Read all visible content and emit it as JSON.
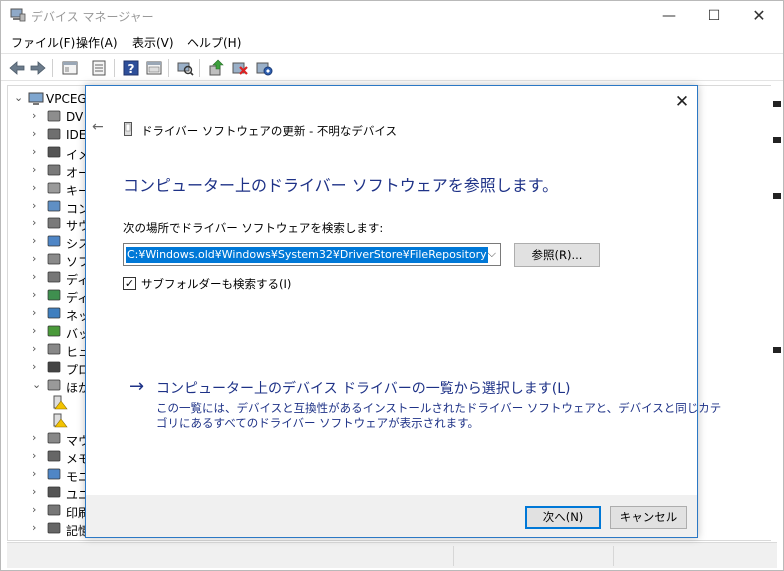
{
  "window": {
    "title": "デバイス マネージャー",
    "controls": {
      "minimize": "—",
      "maximize": "☐",
      "close": "✕"
    }
  },
  "menu": [
    {
      "label": "ファイル(F)"
    },
    {
      "label": "操作(A)"
    },
    {
      "label": "表示(V)"
    },
    {
      "label": "ヘルプ(H)"
    }
  ],
  "toolbar": {
    "buttons": [
      "back-arrow-icon",
      "forward-arrow-icon",
      "properties-icon",
      "list-icon",
      "help-icon",
      "details-icon",
      "scan-hardware-icon",
      "update-driver-icon",
      "disable-device-icon",
      "uninstall-device-icon"
    ]
  },
  "tree": {
    "root": "VPCEG",
    "items": [
      {
        "label": "DV",
        "icon": "disk-drive-icon",
        "expanded": false
      },
      {
        "label": "IDE",
        "icon": "ide-controller-icon",
        "expanded": false
      },
      {
        "label": "イメ",
        "icon": "imaging-device-icon",
        "expanded": false
      },
      {
        "label": "オー",
        "icon": "audio-device-icon",
        "expanded": false
      },
      {
        "label": "キー",
        "icon": "keyboard-icon",
        "expanded": false
      },
      {
        "label": "コン",
        "icon": "computer-icon",
        "expanded": false
      },
      {
        "label": "サウ",
        "icon": "sound-icon",
        "expanded": false
      },
      {
        "label": "シス",
        "icon": "system-device-icon",
        "expanded": false
      },
      {
        "label": "ソフ",
        "icon": "software-device-icon",
        "expanded": false
      },
      {
        "label": "ディ",
        "icon": "disk-icon",
        "expanded": false
      },
      {
        "label": "ディ",
        "icon": "display-adapter-icon",
        "expanded": false
      },
      {
        "label": "ネッ",
        "icon": "network-adapter-icon",
        "expanded": false
      },
      {
        "label": "バッ",
        "icon": "battery-icon",
        "expanded": false
      },
      {
        "label": "ヒュ",
        "icon": "hid-icon",
        "expanded": false
      },
      {
        "label": "プロ",
        "icon": "processor-icon",
        "expanded": false
      },
      {
        "label": "ほか",
        "icon": "other-device-icon",
        "expanded": true
      },
      {
        "label": "",
        "icon": "unknown-device-warning-icon",
        "child": true
      },
      {
        "label": "",
        "icon": "unknown-device-warning-icon",
        "child": true
      },
      {
        "label": "マウ",
        "icon": "mouse-icon",
        "expanded": false
      },
      {
        "label": "メモ",
        "icon": "memory-device-icon",
        "expanded": false
      },
      {
        "label": "モニ",
        "icon": "monitor-icon",
        "expanded": false
      },
      {
        "label": "ユニ",
        "icon": "usb-controller-icon",
        "expanded": false
      },
      {
        "label": "印刷",
        "icon": "print-queue-icon",
        "expanded": false
      },
      {
        "label": "記憶",
        "icon": "storage-controller-icon",
        "expanded": false
      }
    ]
  },
  "dialog": {
    "close": "✕",
    "back": "←",
    "caption": "ドライバー ソフトウェアの更新 - 不明なデバイス",
    "heading": "コンピューター上のドライバー ソフトウェアを参照します。",
    "search_label": "次の場所でドライバー ソフトウェアを検索します:",
    "path_value": "C:¥Windows.old¥Windows¥System32¥DriverStore¥FileRepository",
    "dropdown_glyph": "⌵",
    "browse_label": "参照(R)...",
    "subfolder_checked": true,
    "subfolder_check_glyph": "✓",
    "subfolder_label": "サブフォルダーも検索する(I)",
    "pick_arrow": "→",
    "pick_link": "コンピューター上のデバイス ドライバーの一覧から選択します(L)",
    "pick_desc_line1": "この一覧には、デバイスと互換性があるインストールされたドライバー ソフトウェアと、デバイスと同じカテ",
    "pick_desc_line2": "ゴリにあるすべてのドライバー ソフトウェアが表示されます。",
    "next_label": "次へ(N)",
    "cancel_label": "キャンセル"
  },
  "colors": {
    "dialog_border": "#2b78c5",
    "heading_blue": "#1e3287",
    "selection": "#0078d7",
    "warning_yellow": "#f3c300"
  }
}
